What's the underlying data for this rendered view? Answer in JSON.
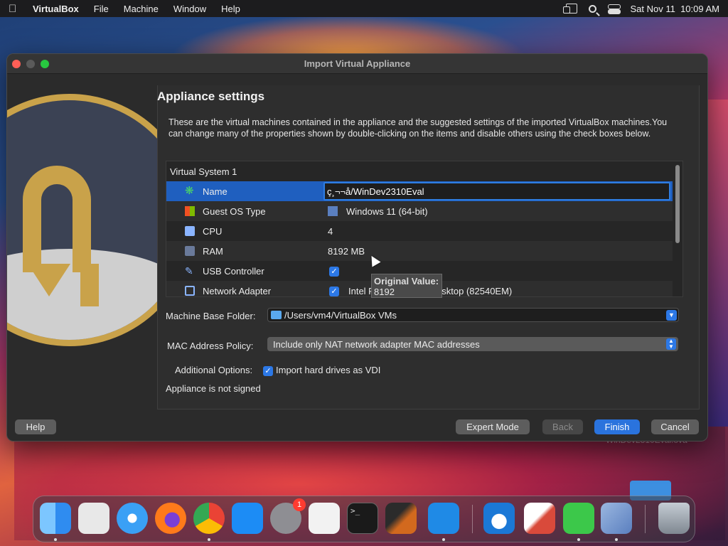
{
  "menubar": {
    "app_name": "VirtualBox",
    "menus": [
      "File",
      "Machine",
      "Window",
      "Help"
    ],
    "datetime": "Sat Nov 11  10:09 AM"
  },
  "window": {
    "title": "Import Virtual Appliance"
  },
  "appliance": {
    "heading": "Appliance settings",
    "description": "These are the virtual machines contained in the appliance and the suggested settings of the imported VirtualBox machines.You can change many of the properties shown by double-clicking on the items and disable others using the check boxes below.",
    "system_label": "Virtual System 1",
    "rows": [
      {
        "key": "Name",
        "value": "ç¸¬¬å/WinDev2310Eval"
      },
      {
        "key": "Guest OS Type",
        "value": "Windows 11 (64-bit)"
      },
      {
        "key": "CPU",
        "value": "4"
      },
      {
        "key": "RAM",
        "value": "8192 MB"
      },
      {
        "key": "USB Controller",
        "value": ""
      },
      {
        "key": "Network Adapter",
        "value": "Intel PRO/1000 MT Desktop (82540EM)"
      }
    ],
    "tooltip": {
      "title": "Original Value:",
      "value": "8192"
    }
  },
  "fields": {
    "base_folder_label": "Machine Base Folder:",
    "base_folder_value": "/Users/vm4/VirtualBox VMs",
    "mac_policy_label": "MAC Address Policy:",
    "mac_policy_value": "Include only NAT network adapter MAC addresses",
    "additional_label": "Additional Options:",
    "import_vdi_label": "Import hard drives as VDI",
    "import_vdi_checked": true,
    "signed_status": "Appliance is not signed"
  },
  "buttons": {
    "help": "Help",
    "expert_mode": "Expert Mode",
    "back": "Back",
    "finish": "Finish",
    "cancel": "Cancel"
  },
  "desktop": {
    "folder_label": "WinDev2310Eval.ova"
  },
  "dock": {
    "items": [
      {
        "name": "finder-icon",
        "color": "#2f8cf0"
      },
      {
        "name": "launchpad-icon",
        "color": "#e8e8e8"
      },
      {
        "name": "safari-icon",
        "color": "#3aa0f5"
      },
      {
        "name": "firefox-icon",
        "color": "#ff7a1a"
      },
      {
        "name": "chrome-icon",
        "color": "#ea4335"
      },
      {
        "name": "app-store-icon",
        "color": "#1c8cf5"
      },
      {
        "name": "system-settings-icon",
        "color": "#8e8e93",
        "badge": "1"
      },
      {
        "name": "textedit-icon",
        "color": "#f2f2f2"
      },
      {
        "name": "terminal-icon",
        "color": "#1a1a1a"
      },
      {
        "name": "garageband-icon",
        "color": "#2b2b2b"
      },
      {
        "name": "vscode-icon",
        "color": "#1f8ae6"
      },
      {
        "name": "onedrive-icon",
        "color": "#1b78d6"
      },
      {
        "name": "remote-desktop-icon",
        "color": "#d94a3b"
      },
      {
        "name": "zip-archiver-icon",
        "color": "#3cc84a"
      },
      {
        "name": "virtualbox-icon",
        "color": "#5a7fbf"
      },
      {
        "name": "trash-icon",
        "color": "#9aa3ad"
      }
    ]
  }
}
